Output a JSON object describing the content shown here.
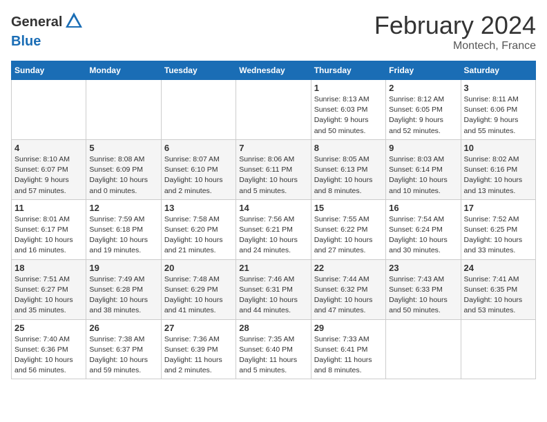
{
  "header": {
    "logo_line1": "General",
    "logo_line2": "Blue",
    "month_title": "February 2024",
    "location": "Montech, France"
  },
  "days_of_week": [
    "Sunday",
    "Monday",
    "Tuesday",
    "Wednesday",
    "Thursday",
    "Friday",
    "Saturday"
  ],
  "weeks": [
    [
      {
        "day": "",
        "info": ""
      },
      {
        "day": "",
        "info": ""
      },
      {
        "day": "",
        "info": ""
      },
      {
        "day": "",
        "info": ""
      },
      {
        "day": "1",
        "info": "Sunrise: 8:13 AM\nSunset: 6:03 PM\nDaylight: 9 hours\nand 50 minutes."
      },
      {
        "day": "2",
        "info": "Sunrise: 8:12 AM\nSunset: 6:05 PM\nDaylight: 9 hours\nand 52 minutes."
      },
      {
        "day": "3",
        "info": "Sunrise: 8:11 AM\nSunset: 6:06 PM\nDaylight: 9 hours\nand 55 minutes."
      }
    ],
    [
      {
        "day": "4",
        "info": "Sunrise: 8:10 AM\nSunset: 6:07 PM\nDaylight: 9 hours\nand 57 minutes."
      },
      {
        "day": "5",
        "info": "Sunrise: 8:08 AM\nSunset: 6:09 PM\nDaylight: 10 hours\nand 0 minutes."
      },
      {
        "day": "6",
        "info": "Sunrise: 8:07 AM\nSunset: 6:10 PM\nDaylight: 10 hours\nand 2 minutes."
      },
      {
        "day": "7",
        "info": "Sunrise: 8:06 AM\nSunset: 6:11 PM\nDaylight: 10 hours\nand 5 minutes."
      },
      {
        "day": "8",
        "info": "Sunrise: 8:05 AM\nSunset: 6:13 PM\nDaylight: 10 hours\nand 8 minutes."
      },
      {
        "day": "9",
        "info": "Sunrise: 8:03 AM\nSunset: 6:14 PM\nDaylight: 10 hours\nand 10 minutes."
      },
      {
        "day": "10",
        "info": "Sunrise: 8:02 AM\nSunset: 6:16 PM\nDaylight: 10 hours\nand 13 minutes."
      }
    ],
    [
      {
        "day": "11",
        "info": "Sunrise: 8:01 AM\nSunset: 6:17 PM\nDaylight: 10 hours\nand 16 minutes."
      },
      {
        "day": "12",
        "info": "Sunrise: 7:59 AM\nSunset: 6:18 PM\nDaylight: 10 hours\nand 19 minutes."
      },
      {
        "day": "13",
        "info": "Sunrise: 7:58 AM\nSunset: 6:20 PM\nDaylight: 10 hours\nand 21 minutes."
      },
      {
        "day": "14",
        "info": "Sunrise: 7:56 AM\nSunset: 6:21 PM\nDaylight: 10 hours\nand 24 minutes."
      },
      {
        "day": "15",
        "info": "Sunrise: 7:55 AM\nSunset: 6:22 PM\nDaylight: 10 hours\nand 27 minutes."
      },
      {
        "day": "16",
        "info": "Sunrise: 7:54 AM\nSunset: 6:24 PM\nDaylight: 10 hours\nand 30 minutes."
      },
      {
        "day": "17",
        "info": "Sunrise: 7:52 AM\nSunset: 6:25 PM\nDaylight: 10 hours\nand 33 minutes."
      }
    ],
    [
      {
        "day": "18",
        "info": "Sunrise: 7:51 AM\nSunset: 6:27 PM\nDaylight: 10 hours\nand 35 minutes."
      },
      {
        "day": "19",
        "info": "Sunrise: 7:49 AM\nSunset: 6:28 PM\nDaylight: 10 hours\nand 38 minutes."
      },
      {
        "day": "20",
        "info": "Sunrise: 7:48 AM\nSunset: 6:29 PM\nDaylight: 10 hours\nand 41 minutes."
      },
      {
        "day": "21",
        "info": "Sunrise: 7:46 AM\nSunset: 6:31 PM\nDaylight: 10 hours\nand 44 minutes."
      },
      {
        "day": "22",
        "info": "Sunrise: 7:44 AM\nSunset: 6:32 PM\nDaylight: 10 hours\nand 47 minutes."
      },
      {
        "day": "23",
        "info": "Sunrise: 7:43 AM\nSunset: 6:33 PM\nDaylight: 10 hours\nand 50 minutes."
      },
      {
        "day": "24",
        "info": "Sunrise: 7:41 AM\nSunset: 6:35 PM\nDaylight: 10 hours\nand 53 minutes."
      }
    ],
    [
      {
        "day": "25",
        "info": "Sunrise: 7:40 AM\nSunset: 6:36 PM\nDaylight: 10 hours\nand 56 minutes."
      },
      {
        "day": "26",
        "info": "Sunrise: 7:38 AM\nSunset: 6:37 PM\nDaylight: 10 hours\nand 59 minutes."
      },
      {
        "day": "27",
        "info": "Sunrise: 7:36 AM\nSunset: 6:39 PM\nDaylight: 11 hours\nand 2 minutes."
      },
      {
        "day": "28",
        "info": "Sunrise: 7:35 AM\nSunset: 6:40 PM\nDaylight: 11 hours\nand 5 minutes."
      },
      {
        "day": "29",
        "info": "Sunrise: 7:33 AM\nSunset: 6:41 PM\nDaylight: 11 hours\nand 8 minutes."
      },
      {
        "day": "",
        "info": ""
      },
      {
        "day": "",
        "info": ""
      }
    ]
  ]
}
